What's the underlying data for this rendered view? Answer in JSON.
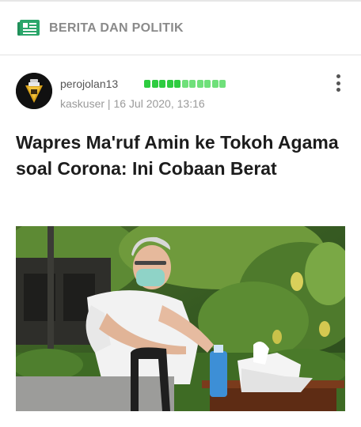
{
  "category": {
    "icon": "newspaper-icon",
    "label": "BERITA DAN POLITIK",
    "color": "#2aa66a"
  },
  "post": {
    "author": "perojolan13",
    "reputation": {
      "filled": 11,
      "max": 11,
      "color": "#2ecc40"
    },
    "role": "kaskuser",
    "date": "16 Jul 2020, 13:16",
    "title": "Wapres Ma'ruf Amin ke Tokoh Agama soal Corona: Ini Cobaan Berat",
    "menu_icon": "more-vertical-icon",
    "image": "photo of elderly man in mask at outdoor table"
  }
}
